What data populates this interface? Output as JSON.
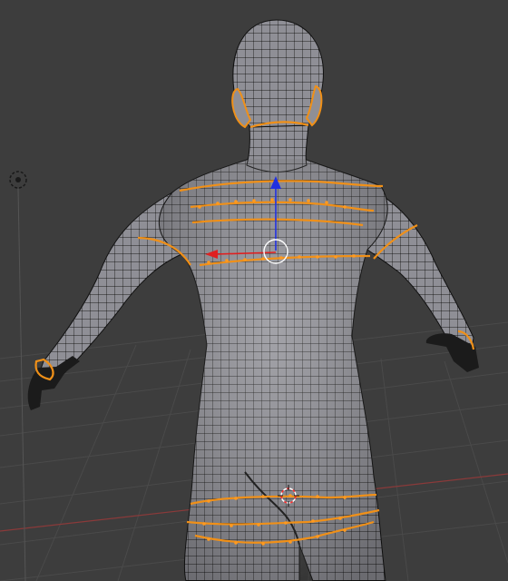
{
  "viewport": {
    "background": "#3d3d3d",
    "grid_color": "#4a4a4a",
    "x_axis_color": "#8a3a3a",
    "y_axis_color": "#3e7a3e",
    "view": "back"
  },
  "mesh": {
    "object": "humanoid-character",
    "mode": "edit-mode-wireframe",
    "surface_color": "#8f8f96",
    "wire_color": "#1a1a1a",
    "selected_edge_color": "#f09018",
    "selected_vertex_color": "#ff9a20",
    "hand_color": "#1b1b1b"
  },
  "selection": {
    "selected_edge_loops": [
      "left-ear",
      "right-ear",
      "neck",
      "upper-back-1",
      "upper-back-2",
      "chest",
      "left-upper-arm",
      "right-upper-arm",
      "left-wrist",
      "right-wrist",
      "hips-upper",
      "hips-lower"
    ]
  },
  "gizmo": {
    "type": "translate",
    "x_axis_color": "#e02020",
    "z_axis_color": "#2030e0",
    "center_ring_color": "#ffffff"
  },
  "scene_objects": {
    "lamp_icon": "lamp-icon",
    "cursor_icon": "3d-cursor-icon",
    "cursor_colors": [
      "#ff3030",
      "#ffffff"
    ]
  }
}
